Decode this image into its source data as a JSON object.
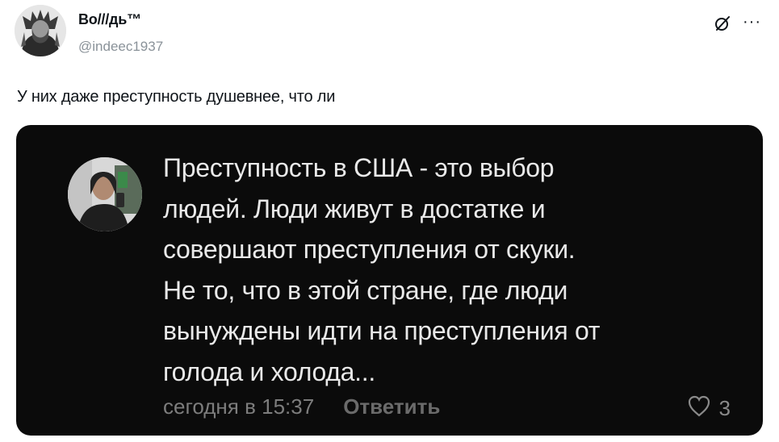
{
  "tweet": {
    "author_name": "Bo///дь™",
    "author_handle": "@indeec1937",
    "text": "У них даже преступность душевнее, что ли"
  },
  "icons": {
    "top_right": [
      "grok-icon",
      "more-options-icon"
    ],
    "more_glyph": "···"
  },
  "embedded_comment": {
    "text": "Преступность в США - это выбор\nлюдей. Люди живут в достатке и\nсовершают преступления от скуки.\nНе то, что в этой стране, где люди\nвынуждены идти на преступления от\nголода и холода...",
    "timestamp": "сегодня в 15:37",
    "reply_label": "Ответить",
    "likes": "3"
  },
  "colors": {
    "handle": "#8a9299",
    "card_bg": "#0b0b0b",
    "comment_text": "#e9e9e9",
    "meta_text": "#7d7d7d"
  }
}
